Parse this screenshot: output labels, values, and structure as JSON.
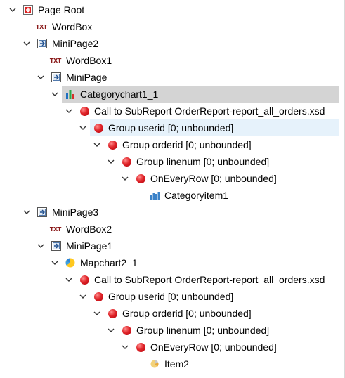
{
  "tree": {
    "rows": [
      {
        "id": "page-root",
        "label": "Page Root",
        "icon": "page-root-icon",
        "expanded": true
      },
      {
        "id": "wordbox",
        "label": "WordBox",
        "icon": "txt-icon",
        "icon_text": "TXT"
      },
      {
        "id": "minipage2",
        "label": "MiniPage2",
        "icon": "minipage-icon",
        "expanded": true
      },
      {
        "id": "wordbox1",
        "label": "WordBox1",
        "icon": "txt-icon",
        "icon_text": "TXT"
      },
      {
        "id": "minipage",
        "label": "MiniPage",
        "icon": "minipage-icon",
        "expanded": true
      },
      {
        "id": "categorychart1-1",
        "label": "Categorychart1_1",
        "icon": "bar-chart-icon",
        "expanded": true,
        "selected": true
      },
      {
        "id": "call-subreport-1",
        "label": "Call to SubReport OrderReport-report_all_orders.xsd",
        "icon": "red-ball-icon",
        "expanded": true
      },
      {
        "id": "group-userid-1",
        "label": "Group userid [0; unbounded]",
        "icon": "red-ball-icon",
        "expanded": true,
        "hovered": true
      },
      {
        "id": "group-orderid-1",
        "label": "Group orderid [0; unbounded]",
        "icon": "red-ball-icon",
        "expanded": true
      },
      {
        "id": "group-linenum-1",
        "label": "Group linenum [0; unbounded]",
        "icon": "red-ball-icon",
        "expanded": true
      },
      {
        "id": "oneveryrow-1",
        "label": "OnEveryRow [0; unbounded]",
        "icon": "red-ball-icon",
        "expanded": true
      },
      {
        "id": "categoryitem1",
        "label": "Categoryitem1",
        "icon": "bar-chart-small-icon"
      },
      {
        "id": "minipage3",
        "label": "MiniPage3",
        "icon": "minipage-icon",
        "expanded": true
      },
      {
        "id": "wordbox2",
        "label": "WordBox2",
        "icon": "txt-icon",
        "icon_text": "TXT"
      },
      {
        "id": "minipage1",
        "label": "MiniPage1",
        "icon": "minipage-icon",
        "expanded": true
      },
      {
        "id": "mapchart2-1",
        "label": "Mapchart2_1",
        "icon": "map-chart-icon",
        "expanded": true
      },
      {
        "id": "call-subreport-2",
        "label": "Call to SubReport OrderReport-report_all_orders.xsd",
        "icon": "red-ball-icon",
        "expanded": true
      },
      {
        "id": "group-userid-2",
        "label": "Group userid [0; unbounded]",
        "icon": "red-ball-icon",
        "expanded": true
      },
      {
        "id": "group-orderid-2",
        "label": "Group orderid [0; unbounded]",
        "icon": "red-ball-icon",
        "expanded": true
      },
      {
        "id": "group-linenum-2",
        "label": "Group linenum [0; unbounded]",
        "icon": "red-ball-icon",
        "expanded": true
      },
      {
        "id": "oneveryrow-2",
        "label": "OnEveryRow [0; unbounded]",
        "icon": "red-ball-icon",
        "expanded": true
      },
      {
        "id": "item2",
        "label": "Item2",
        "icon": "pie-item-icon"
      }
    ]
  },
  "colors": {
    "selected_bg": "#d4d4d4",
    "hover_bg": "#e6f2fb",
    "red_ball": "#e0252a",
    "txt_icon": "#8a1a1a"
  }
}
